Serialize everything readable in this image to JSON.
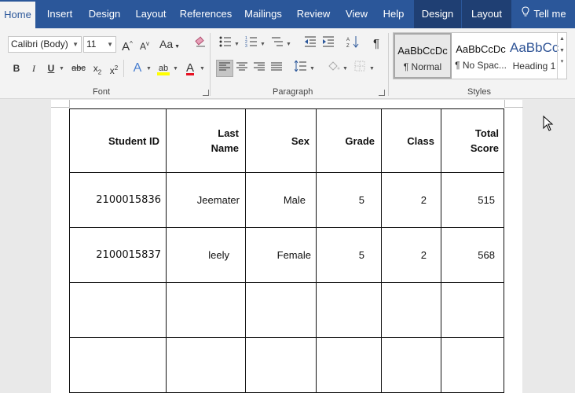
{
  "tabs": [
    {
      "label": "Home",
      "active": true
    },
    {
      "label": "Insert"
    },
    {
      "label": "Design"
    },
    {
      "label": "Layout"
    },
    {
      "label": "References"
    },
    {
      "label": "Mailings"
    },
    {
      "label": "Review"
    },
    {
      "label": "View"
    },
    {
      "label": "Help"
    },
    {
      "label": "Design",
      "contextual": true
    },
    {
      "label": "Layout",
      "contextual": true
    },
    {
      "label": "Tell me"
    }
  ],
  "font": {
    "family": "Calibri (Body)",
    "size": "11",
    "grow_label": "A",
    "shrink_label": "A",
    "case_label": "Aa",
    "bold_label": "B",
    "italic_label": "I",
    "underline_label": "U",
    "strike_label": "abc",
    "subscript_label": "x",
    "superscript_label": "x",
    "effects_label": "A",
    "highlight_label": "ab",
    "color_label": "A",
    "group_label": "Font"
  },
  "paragraph": {
    "pilcrow": "¶",
    "group_label": "Paragraph"
  },
  "styles": {
    "items": [
      {
        "sample": "AaBbCcDc",
        "name": "¶ Normal"
      },
      {
        "sample": "AaBbCcDc",
        "name": "¶ No Spac..."
      },
      {
        "sample": "AaBbCc",
        "name": "Heading 1"
      }
    ],
    "group_label": "Styles"
  },
  "colors": {
    "ribbon_blue": "#2b579a",
    "highlight_yellow": "#ffff00",
    "font_red": "#e81123",
    "heading_blue": "#2f5496"
  },
  "table": {
    "headers": [
      {
        "line1": "Student ID",
        "line2": ""
      },
      {
        "line1": "Last",
        "line2": "Name"
      },
      {
        "line1": "Sex",
        "line2": ""
      },
      {
        "line1": "Grade",
        "line2": ""
      },
      {
        "line1": "Class",
        "line2": ""
      },
      {
        "line1": "Total",
        "line2": "Score"
      }
    ],
    "rows": [
      [
        "2100015836",
        "Jeemater",
        "Male",
        "5",
        "2",
        "515"
      ],
      [
        "2100015837",
        "leely",
        "Female",
        "5",
        "2",
        "568"
      ],
      [
        "",
        "",
        "",
        "",
        "",
        ""
      ],
      [
        "",
        "",
        "",
        "",
        "",
        ""
      ]
    ]
  }
}
